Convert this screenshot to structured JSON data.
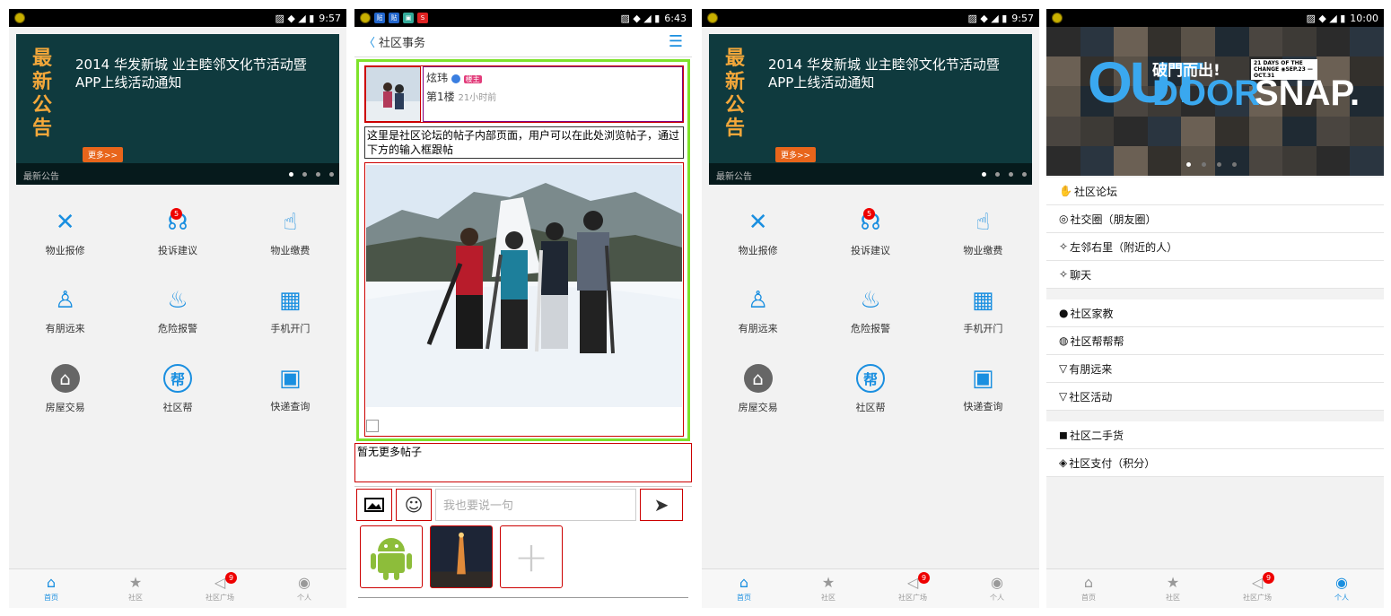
{
  "screens": [
    {
      "status": {
        "time": "9:57"
      },
      "banner": {
        "big": [
          "最",
          "新",
          "公",
          "告"
        ],
        "text": "2014 华发新城 业主睦邻文化节活动暨APP上线活动通知",
        "more": "更多>>",
        "footer": "最新公告"
      },
      "grid": [
        {
          "label": "物业报修",
          "icon": "wrench-icon",
          "glyph": "✕"
        },
        {
          "label": "投诉建议",
          "icon": "headset-icon",
          "glyph": "☊",
          "badge": "5"
        },
        {
          "label": "物业缴费",
          "icon": "payment-icon",
          "glyph": "☝"
        },
        {
          "label": "有朋远来",
          "icon": "visitor-icon",
          "glyph": "♙"
        },
        {
          "label": "危险报警",
          "icon": "alarm-icon",
          "glyph": "♨"
        },
        {
          "label": "手机开门",
          "icon": "qrcode-icon",
          "glyph": "▦"
        },
        {
          "label": "房屋交易",
          "icon": "house-icon",
          "glyph": "⌂"
        },
        {
          "label": "社区帮",
          "icon": "help-icon",
          "glyph": "帮"
        },
        {
          "label": "快递查询",
          "icon": "box-icon",
          "glyph": "▣"
        }
      ]
    },
    {
      "status": {
        "time": "6:43"
      },
      "nav": {
        "title": "社区事务"
      },
      "post": {
        "author": "炫玮",
        "tag": "楼主",
        "floor": "第1楼",
        "time": "21小时前",
        "body": "这里是社区论坛的帖子内部页面，用户可以在此处浏览帖子，通过下方的输入框跟帖"
      },
      "nomore": "暂无更多帖子",
      "input": {
        "placeholder": "我也要说一句"
      }
    },
    {
      "status": {
        "time": "9:57"
      }
    },
    {
      "status": {
        "time": "10:00"
      },
      "banner": {
        "outdoor_a": "OUT",
        "outdoor_b": "破門而出!",
        "outdoor_c": "DOOR",
        "outdoor_d": "SNAP.",
        "outdoor_e": "21 DAYS OF THE CHANGE ◉SEP.23 — OCT.31"
      },
      "menu1": [
        {
          "label": "社区论坛",
          "glyph": "✋"
        },
        {
          "label": "社交圈（朋友圈）",
          "glyph": "◎"
        },
        {
          "label": "左邻右里（附近的人）",
          "glyph": "✧"
        },
        {
          "label": "聊天",
          "glyph": "✧"
        }
      ],
      "menu2": [
        {
          "label": "社区家教",
          "glyph": "●"
        },
        {
          "label": "社区帮帮帮",
          "glyph": "◍"
        },
        {
          "label": "有朋远来",
          "glyph": "▽"
        },
        {
          "label": "社区活动",
          "glyph": "▽"
        }
      ],
      "menu3": [
        {
          "label": "社区二手货",
          "glyph": "◼"
        },
        {
          "label": "社区支付（积分）",
          "glyph": "◈"
        }
      ]
    }
  ],
  "tabbar": [
    {
      "label": "首页",
      "glyph": "⌂",
      "icon": "home-icon"
    },
    {
      "label": "社区",
      "glyph": "★",
      "icon": "community-icon"
    },
    {
      "label": "社区广场",
      "glyph": "◁",
      "icon": "square-icon",
      "badge": "9"
    },
    {
      "label": "个人",
      "glyph": "◉",
      "icon": "person-icon"
    }
  ]
}
